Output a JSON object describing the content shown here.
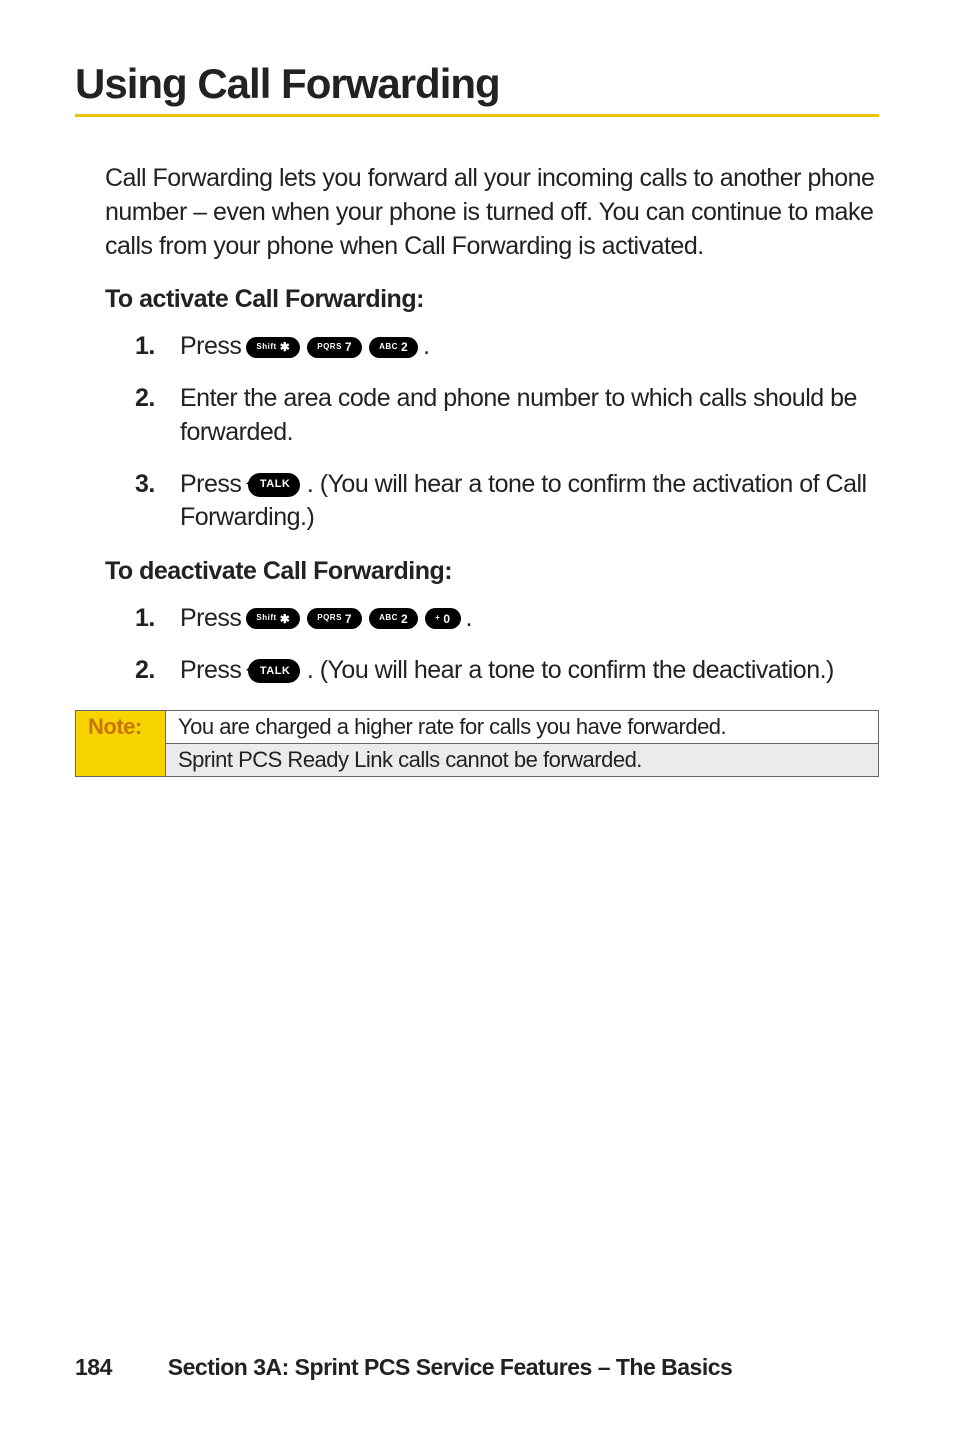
{
  "heading": "Using Call Forwarding",
  "intro": "Call Forwarding lets you forward all your incoming calls to another phone number – even when your phone is turned off. You can continue to make calls from your phone when Call Forwarding is activated.",
  "activate": {
    "title": "To activate Call Forwarding:",
    "steps": {
      "s1": {
        "num": "1.",
        "press": "Press",
        "keys": {
          "k1a": "Shift",
          "k1b": "✱",
          "k2a": "PQRS",
          "k2b": "7",
          "k3a": "ABC",
          "k3b": "2"
        },
        "period": "."
      },
      "s2": {
        "num": "2.",
        "text": "Enter the area code and phone number to which calls should be forwarded."
      },
      "s3": {
        "num": "3.",
        "press": "Press",
        "talk": "TALK",
        "tail": ". (You will hear a tone to confirm the activation of Call Forwarding.)"
      }
    }
  },
  "deactivate": {
    "title": "To deactivate Call Forwarding:",
    "steps": {
      "s1": {
        "num": "1.",
        "press": "Press",
        "keys": {
          "k1a": "Shift",
          "k1b": "✱",
          "k2a": "PQRS",
          "k2b": "7",
          "k3a": "ABC",
          "k3b": "2",
          "k4a": "+",
          "k4b": "0"
        },
        "period": "."
      },
      "s2": {
        "num": "2.",
        "press": "Press",
        "talk": "TALK",
        "tail": ". (You will hear a tone to confirm the deactivation.)"
      }
    }
  },
  "note": {
    "label": "Note:",
    "line1": "You are charged a higher rate for calls you have forwarded.",
    "line2": "Sprint PCS Ready Link calls cannot be forwarded."
  },
  "footer": {
    "page": "184",
    "section": "Section 3A: Sprint PCS Service Features – The Basics"
  }
}
